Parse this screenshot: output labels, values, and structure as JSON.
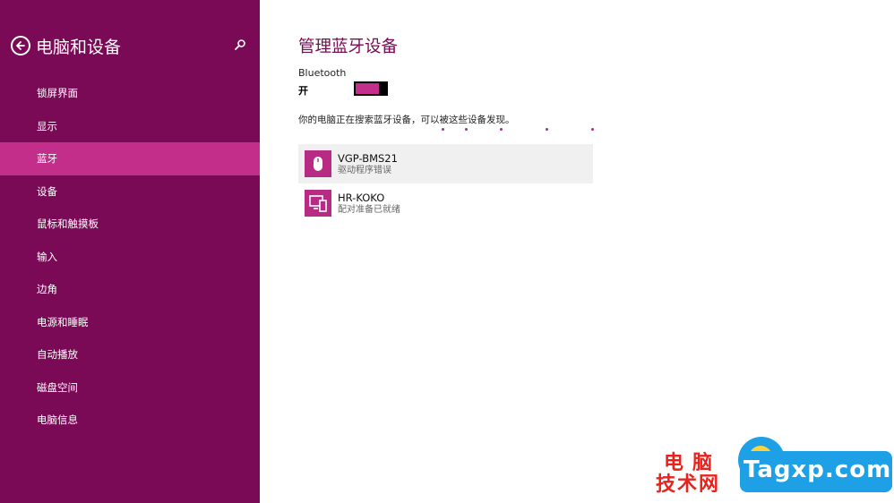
{
  "sidebar": {
    "title": "电脑和设备",
    "items": [
      {
        "label": "锁屏界面",
        "active": false
      },
      {
        "label": "显示",
        "active": false
      },
      {
        "label": "蓝牙",
        "active": true
      },
      {
        "label": "设备",
        "active": false
      },
      {
        "label": "鼠标和触摸板",
        "active": false
      },
      {
        "label": "输入",
        "active": false
      },
      {
        "label": "边角",
        "active": false
      },
      {
        "label": "电源和睡眠",
        "active": false
      },
      {
        "label": "自动播放",
        "active": false
      },
      {
        "label": "磁盘空间",
        "active": false
      },
      {
        "label": "电脑信息",
        "active": false
      }
    ]
  },
  "main": {
    "title": "管理蓝牙设备",
    "bluetooth_label": "Bluetooth",
    "bluetooth_state": "开",
    "bluetooth_on": true,
    "search_message": "你的电脑正在搜索蓝牙设备，可以被这些设备发现。",
    "devices": [
      {
        "name": "VGP-BMS21",
        "status": "驱动程序错误",
        "icon": "mouse-icon",
        "selected": true
      },
      {
        "name": "HR-KOKO",
        "status": "配对准备已就绪",
        "icon": "phone-pc-icon",
        "selected": false
      }
    ]
  },
  "watermark": {
    "cn_line1": "电脑",
    "cn_line2": "技术网",
    "site": "Tagxp.com"
  },
  "colors": {
    "sidebar_bg": "#7a0a55",
    "accent": "#c22e8a",
    "title": "#7a0a55"
  }
}
